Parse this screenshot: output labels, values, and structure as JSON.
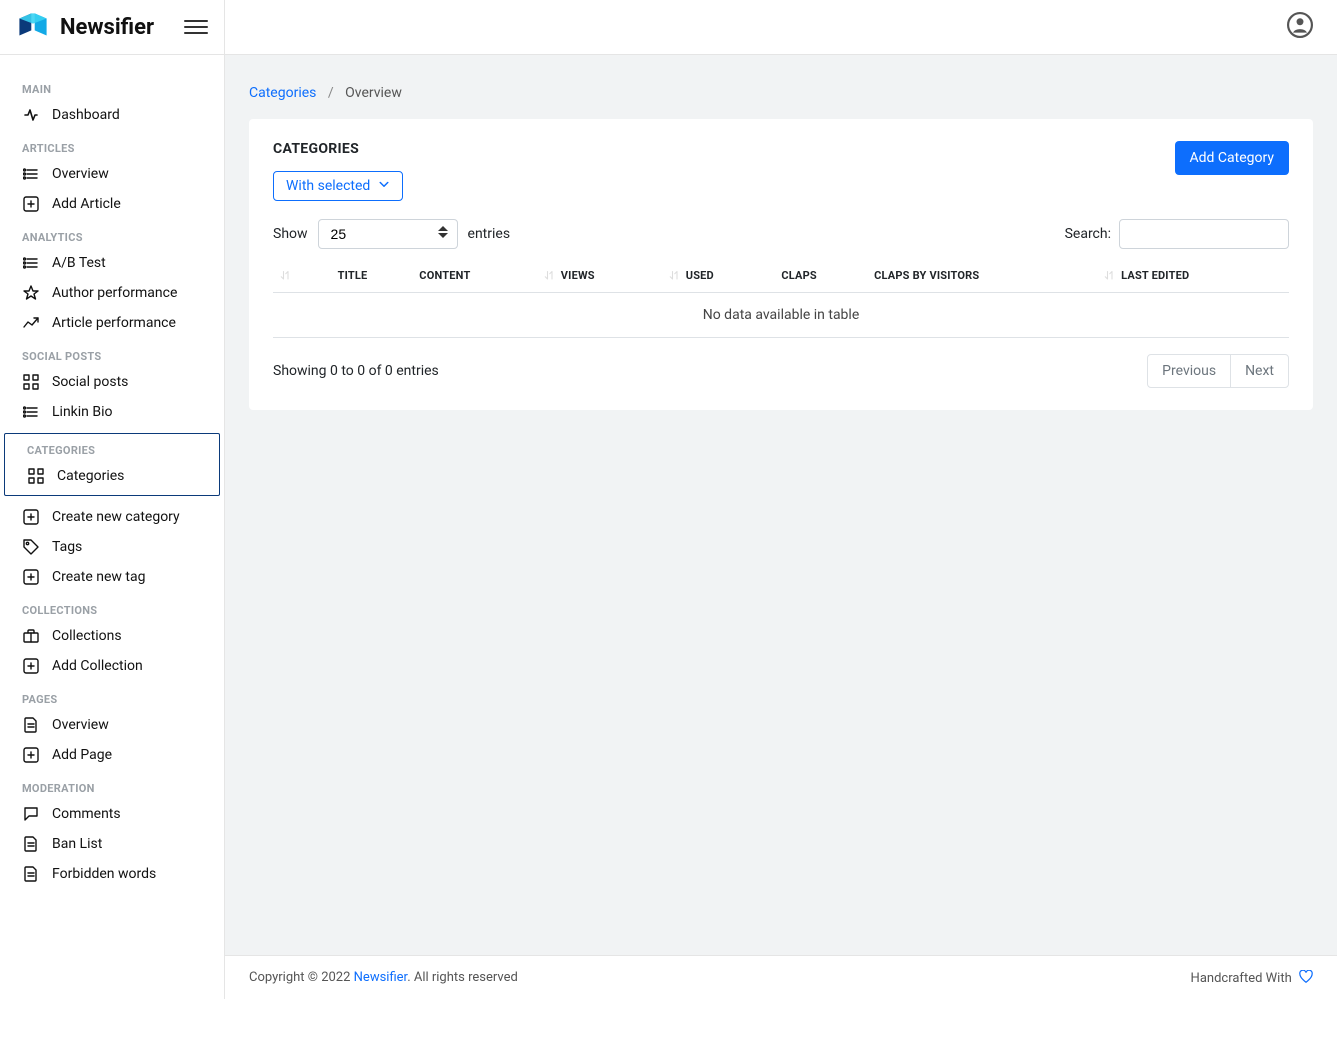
{
  "app": {
    "name": "Newsifier"
  },
  "breadcrumb": {
    "root": "Categories",
    "current": "Overview"
  },
  "sidebar": {
    "sections": [
      {
        "title": "MAIN",
        "items": [
          {
            "label": "Dashboard",
            "icon": "activity"
          }
        ]
      },
      {
        "title": "ARTICLES",
        "items": [
          {
            "label": "Overview",
            "icon": "list"
          },
          {
            "label": "Add Article",
            "icon": "plus-square"
          }
        ]
      },
      {
        "title": "ANALYTICS",
        "items": [
          {
            "label": "A/B Test",
            "icon": "list"
          },
          {
            "label": "Author performance",
            "icon": "star"
          },
          {
            "label": "Article performance",
            "icon": "trend"
          }
        ]
      },
      {
        "title": "SOCIAL POSTS",
        "items": [
          {
            "label": "Social posts",
            "icon": "grid"
          },
          {
            "label": "Linkin Bio",
            "icon": "list"
          }
        ]
      },
      {
        "title": "CATEGORIES",
        "box": true,
        "items": [
          {
            "label": "Categories",
            "icon": "grid",
            "active": true
          },
          {
            "label": "Create new category",
            "icon": "plus-square"
          },
          {
            "label": "Tags",
            "icon": "tag"
          },
          {
            "label": "Create new tag",
            "icon": "plus-square"
          }
        ]
      },
      {
        "title": "COLLECTIONS",
        "items": [
          {
            "label": "Collections",
            "icon": "briefcase"
          },
          {
            "label": "Add Collection",
            "icon": "plus-square"
          }
        ]
      },
      {
        "title": "PAGES",
        "items": [
          {
            "label": "Overview",
            "icon": "file"
          },
          {
            "label": "Add Page",
            "icon": "plus-square"
          }
        ]
      },
      {
        "title": "MODERATION",
        "items": [
          {
            "label": "Comments",
            "icon": "message"
          },
          {
            "label": "Ban List",
            "icon": "file"
          },
          {
            "label": "Forbidden words",
            "icon": "file"
          }
        ]
      }
    ]
  },
  "page": {
    "card_title": "CATEGORIES",
    "add_button": "Add Category",
    "with_selected": "With selected",
    "show_label": "Show",
    "entries_label": "entries",
    "entries_value": "25",
    "search_label": "Search:",
    "columns": [
      {
        "key": "sortspacer",
        "label": "",
        "sortable": true
      },
      {
        "key": "title",
        "label": "TITLE",
        "sortable": false
      },
      {
        "key": "content",
        "label": "CONTENT",
        "sortable": false
      },
      {
        "key": "views",
        "label": "VIEWS",
        "sortable": true
      },
      {
        "key": "used",
        "label": "USED",
        "sortable": true
      },
      {
        "key": "claps",
        "label": "CLAPS",
        "sortable": false
      },
      {
        "key": "cbv",
        "label": "CLAPS BY VISITORS",
        "sortable": false
      },
      {
        "key": "lastedited",
        "label": "LAST EDITED",
        "sortable": true
      }
    ],
    "no_data": "No data available in table",
    "showing": "Showing 0 to 0 of 0 entries",
    "prev": "Previous",
    "next": "Next"
  },
  "footer": {
    "copyright_pre": "Copyright © 2022 ",
    "brand": "Newsifier",
    "copyright_post": ". All rights reserved",
    "handcrafted": "Handcrafted With"
  }
}
